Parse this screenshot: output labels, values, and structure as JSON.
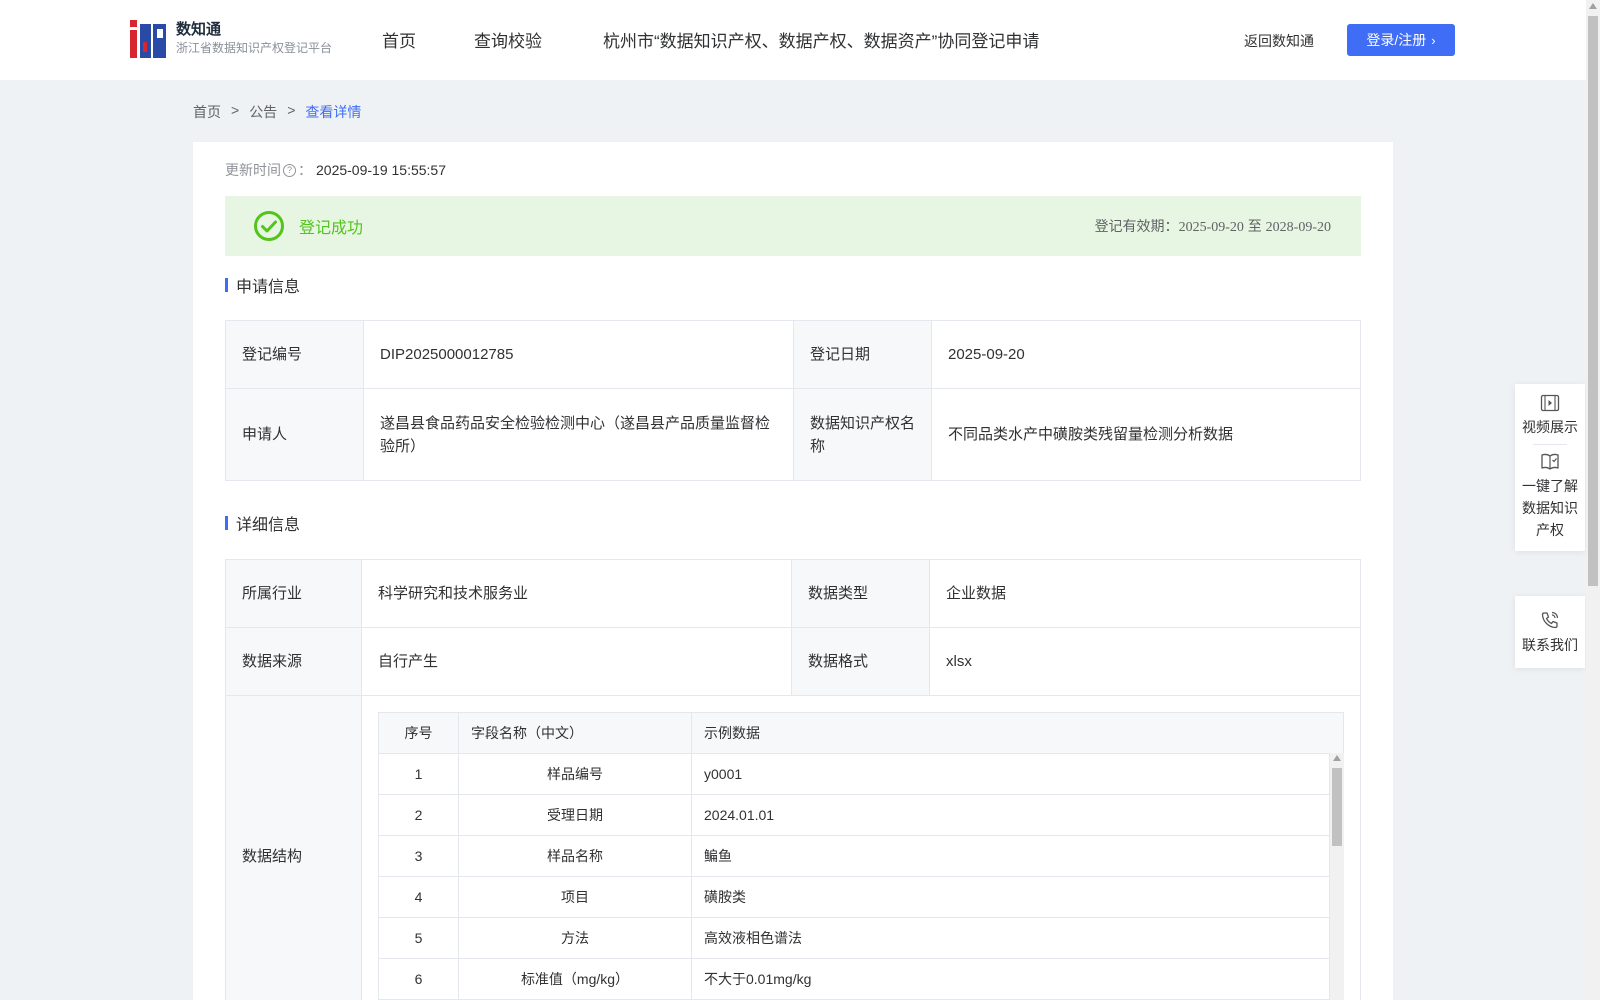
{
  "header": {
    "brand_name": "数知通",
    "brand_subtitle": "浙江省数据知识产权登记平台",
    "nav": [
      "首页",
      "查询校验",
      "杭州市“数据知识产权、数据产权、数据资产”协同登记申请"
    ],
    "back_link": "返回数知通",
    "login_label": "登录/注册"
  },
  "breadcrumb": [
    "首页",
    ">",
    "公告",
    ">",
    "查看详情"
  ],
  "update": {
    "label": "更新时间",
    "sep": "：",
    "value": "2025-09-19 15:55:57"
  },
  "status": {
    "text": "登记成功",
    "validity_label": "登记有效期：",
    "validity_start": "2025-09-20",
    "validity_to": "至",
    "validity_end": "2028-09-20",
    "color": "#52c41a"
  },
  "application": {
    "title": "申请信息",
    "reg_no_label": "登记编号",
    "reg_no": "DIP2025000012785",
    "reg_date_label": "登记日期",
    "reg_date": "2025-09-20",
    "applicant_label": "申请人",
    "applicant": "遂昌县食品药品安全检验检测中心（遂昌县产品质量监督检验所）",
    "ip_name_label": "数据知识产权名称",
    "ip_name": "不同品类水产中磺胺类残留量检测分析数据"
  },
  "detail": {
    "title": "详细信息",
    "industry_label": "所属行业",
    "industry": "科学研究和技术服务业",
    "data_type_label": "数据类型",
    "data_type": "企业数据",
    "source_label": "数据来源",
    "source": "自行产生",
    "format_label": "数据格式",
    "format": "xlsx",
    "structure_label": "数据结构",
    "structure_headers": [
      "序号",
      "字段名称（中文）",
      "示例数据"
    ],
    "structure_rows": [
      [
        "1",
        "样品编号",
        "y0001"
      ],
      [
        "2",
        "受理日期",
        "2024.01.01"
      ],
      [
        "3",
        "样品名称",
        "鳊鱼"
      ],
      [
        "4",
        "项目",
        "磺胺类"
      ],
      [
        "5",
        "方法",
        "高效液相色谱法"
      ],
      [
        "6",
        "标准值（mg/kg）",
        "不大于0.01mg/kg"
      ]
    ]
  },
  "float_panel": {
    "video": "视频展示",
    "learn": "一键了解数据知识产权",
    "contact": "联系我们"
  },
  "colors": {
    "accent": "#3f6df5",
    "success_bg": "#e7f6e2",
    "page_bg": "#eef2f5"
  }
}
